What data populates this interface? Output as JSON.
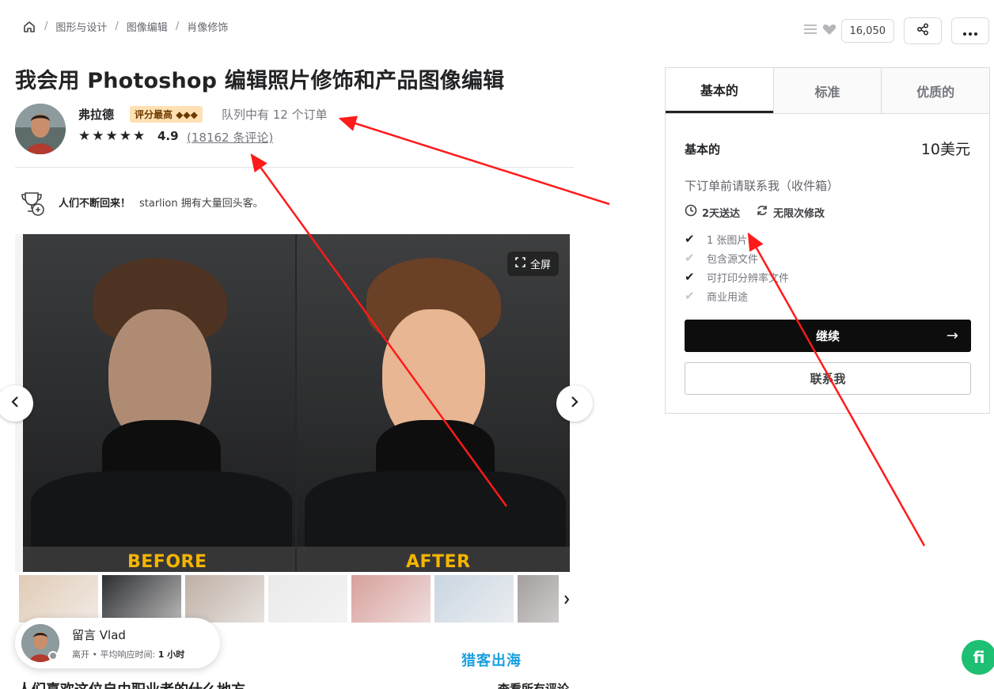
{
  "breadcrumb": {
    "items": [
      "图形与设计",
      "图像编辑",
      "肖像修饰"
    ],
    "separator": "/"
  },
  "top_actions": {
    "likes": "16,050"
  },
  "gig": {
    "title": "我会用 Photoshop 编辑照片修饰和产品图像编辑"
  },
  "seller": {
    "name": "弗拉德",
    "badge": "评分最高 ◆◆◆",
    "queue": "队列中有 12 个订单",
    "stars": "★★★★★",
    "rating": "4.9",
    "reviews": "(18162 条评论)"
  },
  "repeat": {
    "bold": "人们不断回来！",
    "text": "starlion 拥有大量回头客。"
  },
  "gallery": {
    "fullscreen_label": "全屏",
    "before_label": "BEFORE",
    "after_label": "AFTER",
    "thumbnails": [
      {
        "color": "#c8a07a"
      },
      {
        "color": "#2c2d2f"
      },
      {
        "color": "#8a6e5a"
      },
      {
        "color": "#d9d9d9"
      },
      {
        "color": "#b8514a"
      },
      {
        "color": "#9fb4c8"
      },
      {
        "color": "#5a5050"
      }
    ]
  },
  "contact_popup": {
    "title": "留言 Vlad",
    "status": "离开",
    "response_label": "平均响应时间:",
    "response_value": "1 小时"
  },
  "watermark": "猎客出海",
  "section_heading": "人们喜欢这位自由职业者的什么地方",
  "see_all_reviews": "查看所有评论",
  "fab_label": "fi",
  "package": {
    "tabs": [
      "基本的",
      "标准",
      "优质的"
    ],
    "active_tab": "基本的",
    "name": "基本的",
    "price": "10美元",
    "description": "下订单前请联系我（收件箱）",
    "delivery": "2天送达",
    "revisions": "无限次修改",
    "features": [
      {
        "label": "1 张图片",
        "included": true
      },
      {
        "label": "包含源文件",
        "included": false
      },
      {
        "label": "可打印分辨率文件",
        "included": true
      },
      {
        "label": "商业用途",
        "included": false
      }
    ],
    "continue_label": "继续",
    "contact_label": "联系我"
  },
  "colors": {
    "annotation_red": "#ff1a1a",
    "accent_green": "#1dbf73",
    "badge_bg": "#ffe0b3"
  }
}
